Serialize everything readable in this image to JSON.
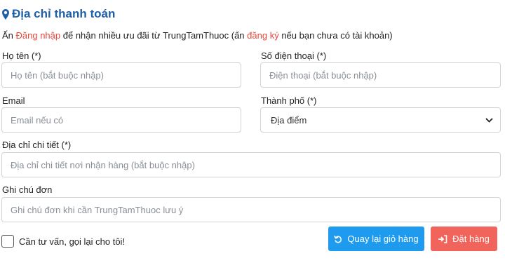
{
  "section": {
    "title": "Địa chỉ thanh toán",
    "icon": "map-marker-icon",
    "accent_color": "#1f5fa8"
  },
  "notice": {
    "part1": "Ấn ",
    "login_link": "Đăng nhập",
    "part2": " để nhận nhiều ưu đãi từ TrungTamThuoc (ấn ",
    "register_link": "đăng ký",
    "part3": " nếu bạn chưa có tài khoản)",
    "link_color": "#e8463b"
  },
  "form": {
    "name": {
      "label": "Họ tên (*)",
      "placeholder": "Họ tên (bắt buộc nhập)",
      "value": ""
    },
    "phone": {
      "label": "Số điện thoại (*)",
      "placeholder": "Điện thoại (bắt buộc nhập)",
      "value": ""
    },
    "email": {
      "label": "Email",
      "placeholder": "Email nếu có",
      "value": ""
    },
    "city": {
      "label": "Thành phố (*)",
      "selected": "Địa điểm",
      "icon": "chevron-down-icon"
    },
    "address": {
      "label": "Địa chỉ chi tiết (*)",
      "placeholder": "Địa chỉ chi tiết nơi nhận hàng (bắt buộc nhập)",
      "value": ""
    },
    "note": {
      "label": "Ghi chú đơn",
      "placeholder": "Ghi chú đơn khi cần TrungTamThuoc lưu ý",
      "value": ""
    }
  },
  "consult": {
    "label": "Cần tư vấn, gọi lại cho tôi!",
    "checked": false
  },
  "buttons": {
    "back": {
      "label": "Quay lại giỏ hàng",
      "icon": "undo-icon",
      "color": "#1e9bef"
    },
    "order": {
      "label": "Đặt hàng",
      "icon": "sign-in-icon",
      "color": "#f0645b"
    }
  }
}
